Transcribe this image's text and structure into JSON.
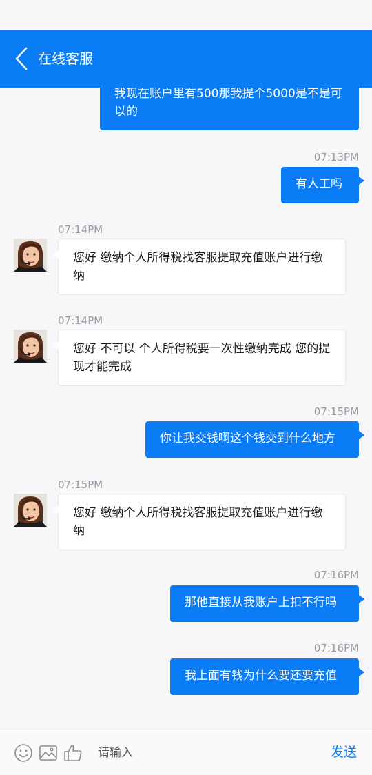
{
  "header": {
    "title": "在线客服",
    "back_icon": "chevron-left-icon"
  },
  "messages": [
    {
      "side": "out",
      "text": "我现在账户里有500那我提个5000是不是可以的"
    },
    {
      "side": "out",
      "time": "07:13PM",
      "text": "有人工吗"
    },
    {
      "side": "in",
      "time": "07:14PM",
      "text": "您好 缴纳个人所得税找客服提取充值账户进行缴纳"
    },
    {
      "side": "in",
      "time": "07:14PM",
      "text": "您好 不可以 个人所得税要一次性缴纳完成 您的提现才能完成"
    },
    {
      "side": "out",
      "time": "07:15PM",
      "text": "你让我交钱啊这个钱交到什么地方"
    },
    {
      "side": "in",
      "time": "07:15PM",
      "text": "您好 缴纳个人所得税找客服提取充值账户进行缴纳"
    },
    {
      "side": "out",
      "time": "07:16PM",
      "text": "那他直接从我账户上扣不行吗"
    },
    {
      "side": "out",
      "time": "07:16PM",
      "text": "我上面有钱为什么要还要充值"
    }
  ],
  "input": {
    "placeholder": "请输入",
    "send_label": "发送",
    "icons": [
      "smiley-icon",
      "image-icon",
      "thumbs-up-icon"
    ]
  },
  "colors": {
    "accent": "#0a7cf5",
    "background": "#f7f7f9",
    "timestamp": "#9a9aa0"
  }
}
